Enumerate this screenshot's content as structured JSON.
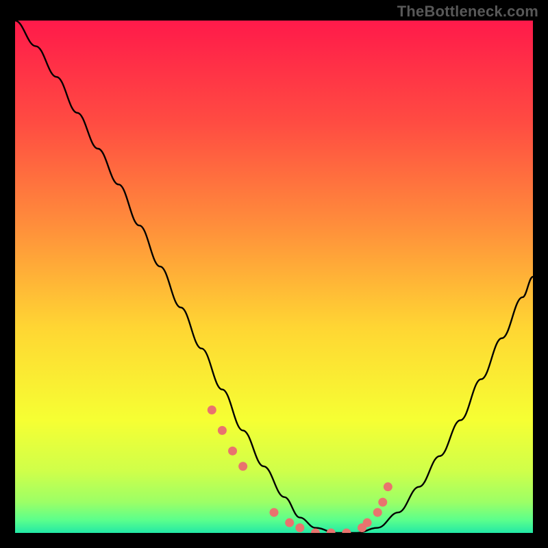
{
  "watermark": "TheBottleneck.com",
  "colors": {
    "background": "#000000",
    "curve": "#000000",
    "salmon": "#E9736E",
    "gradient_stops": [
      {
        "offset": 0.0,
        "color": "#FF1A4A"
      },
      {
        "offset": 0.2,
        "color": "#FF4C42"
      },
      {
        "offset": 0.4,
        "color": "#FF8E3B"
      },
      {
        "offset": 0.6,
        "color": "#FFD633"
      },
      {
        "offset": 0.78,
        "color": "#F6FF33"
      },
      {
        "offset": 0.88,
        "color": "#CFFF4A"
      },
      {
        "offset": 0.94,
        "color": "#9CFF66"
      },
      {
        "offset": 0.975,
        "color": "#5BFF8C"
      },
      {
        "offset": 1.0,
        "color": "#22E9A6"
      }
    ]
  },
  "chart_data": {
    "type": "line",
    "title": "",
    "xlabel": "",
    "ylabel": "",
    "xlim": [
      0,
      100
    ],
    "ylim": [
      0,
      100
    ],
    "grid": false,
    "legend": false,
    "series": [
      {
        "name": "bottleneck-curve",
        "x": [
          0,
          4,
          8,
          12,
          16,
          20,
          24,
          28,
          32,
          36,
          40,
          44,
          48,
          52,
          55,
          58,
          62,
          66,
          70,
          74,
          78,
          82,
          86,
          90,
          94,
          98,
          100
        ],
        "y": [
          100,
          95,
          89,
          82,
          75,
          68,
          60,
          52,
          44,
          36,
          28,
          20,
          13,
          7,
          3,
          1,
          0,
          0,
          1,
          4,
          9,
          15,
          22,
          30,
          38,
          46,
          50
        ]
      }
    ],
    "markers": {
      "name": "salmon-dots",
      "x": [
        38,
        40,
        42,
        44,
        50,
        53,
        55,
        58,
        61,
        64,
        67,
        68,
        70,
        71,
        72
      ],
      "y": [
        24,
        20,
        16,
        13,
        4,
        2,
        1,
        0,
        0,
        0,
        1,
        2,
        4,
        6,
        9
      ]
    }
  }
}
